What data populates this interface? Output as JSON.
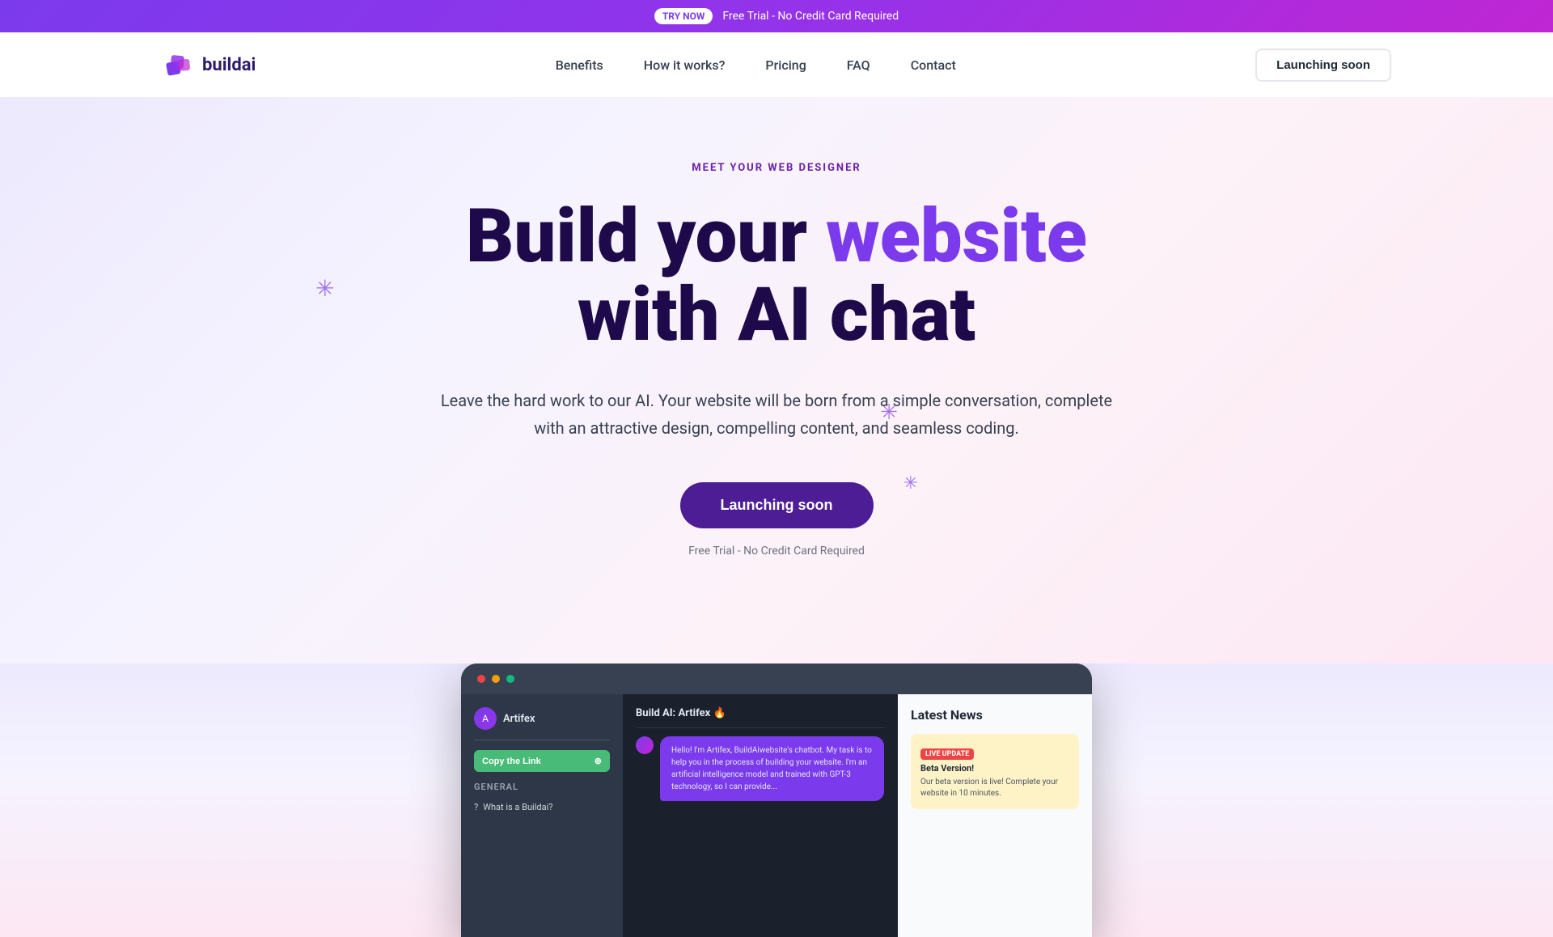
{
  "banner": {
    "try_now_label": "TRY NOW",
    "description": "Free Trial - No Credit Card Required"
  },
  "navbar": {
    "logo_text": "buildai",
    "links": [
      {
        "label": "Benefits",
        "id": "benefits"
      },
      {
        "label": "How it works?",
        "id": "how-it-works"
      },
      {
        "label": "Pricing",
        "id": "pricing"
      },
      {
        "label": "FAQ",
        "id": "faq"
      },
      {
        "label": "Contact",
        "id": "contact"
      }
    ],
    "cta_label": "Launching soon"
  },
  "hero": {
    "subtitle": "MEET YOUR WEB DESIGNER",
    "title_part1": "Build your ",
    "title_purple": "website",
    "title_part2": "with AI chat",
    "description": "Leave the hard work to our AI. Your website will be born from a simple conversation, complete with an attractive design, compelling content, and seamless coding.",
    "cta_label": "Launching soon",
    "free_trial_text": "Free Trial - No Credit Card Required"
  },
  "app_preview": {
    "sidebar": {
      "name": "Artifex",
      "copy_link_btn": "Copy the Link",
      "section_label": "General",
      "question": "What is a Buildai?"
    },
    "chat": {
      "header": "Build AI: Artifex 🔥",
      "avatar_label": "A",
      "message": "Hello! I'm Artifex, BuildAiwebsite's chatbot. My task is to help you in the process of building your website. I'm an artificial intelligence model and trained with GPT-3 technology, so I can provide..."
    },
    "right_panel": {
      "title": "Latest News",
      "badge": "LIVE UPDATE",
      "card_title": "Beta Version!",
      "card_text": "Our beta version is live! Complete your website in 10 minutes."
    }
  },
  "decorations": {
    "plus1": "✳",
    "plus2": "✳",
    "plus3": "✳"
  }
}
